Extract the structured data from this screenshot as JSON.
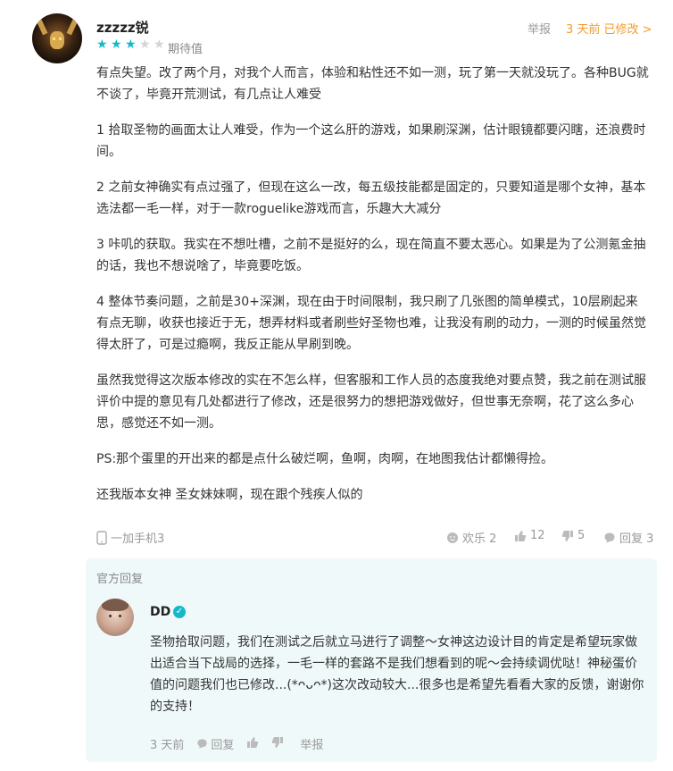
{
  "review": {
    "username": "zzzzz锐",
    "rating": 3,
    "rating_max": 5,
    "expect_label": "期待值",
    "report_label": "举报",
    "time_modified": "3 天前 已修改 >",
    "paragraphs": [
      "有点失望。改了两个月，对我个人而言，体验和粘性还不如一测，玩了第一天就没玩了。各种BUG就不谈了，毕竟开荒测试，有几点让人难受",
      "1 拾取圣物的画面太让人难受，作为一个这么肝的游戏，如果刷深渊，估计眼镜都要闪瞎，还浪费时间。",
      "2 之前女神确实有点过强了，但现在这么一改，每五级技能都是固定的，只要知道是哪个女神，基本选法都一毛一样，对于一款roguelike游戏而言，乐趣大大减分",
      "3 咔叽的获取。我实在不想吐槽，之前不是挺好的么，现在简直不要太恶心。如果是为了公测氪金抽的话，我也不想说啥了，毕竟要吃饭。",
      "4 整体节奏问题，之前是30+深渊，现在由于时间限制，我只刷了几张图的简单模式，10层刷起来有点无聊，收获也接近于无，想弄材料或者刷些好圣物也难，让我没有刷的动力，一测的时候虽然觉得太肝了，可是过瘾啊，我反正能从早刷到晚。",
      "虽然我觉得这次版本修改的实在不怎么样，但客服和工作人员的态度我绝对要点赞，我之前在测试服评价中提的意见有几处都进行了修改，还是很努力的想把游戏做好，但世事无奈啊，花了这么多心思，感觉还不如一测。",
      "PS:那个蛋里的开出来的都是点什么破烂啊，鱼啊，肉啊，在地图我估计都懒得捡。",
      "还我版本女神 圣女妹妹啊，现在跟个残疾人似的"
    ],
    "device": "一加手机3",
    "happy_label": "欢乐 2",
    "likes": "12",
    "dislikes": "5",
    "replies_label": "回复 3"
  },
  "official_reply": {
    "section_title": "官方回复",
    "name": "DD",
    "verified_mark": "✓",
    "text": "圣物拾取问题，我们在测试之后就立马进行了调整～女神这边设计目的肯定是希望玩家做出适合当下战局的选择，一毛一样的套路不是我们想看到的呢～会持续调优哒！神秘蛋价值的问题我们也已修改...(*ᴖᴗᴖ*)这次改动较大...很多也是希望先看看大家的反馈，谢谢你的支持！",
    "time": "3 天前",
    "reply_label": "回复",
    "report_label": "举报"
  },
  "colors": {
    "accent": "#14b9c8",
    "modified": "#f39c2c",
    "reply_bg": "#f0f9f9"
  }
}
